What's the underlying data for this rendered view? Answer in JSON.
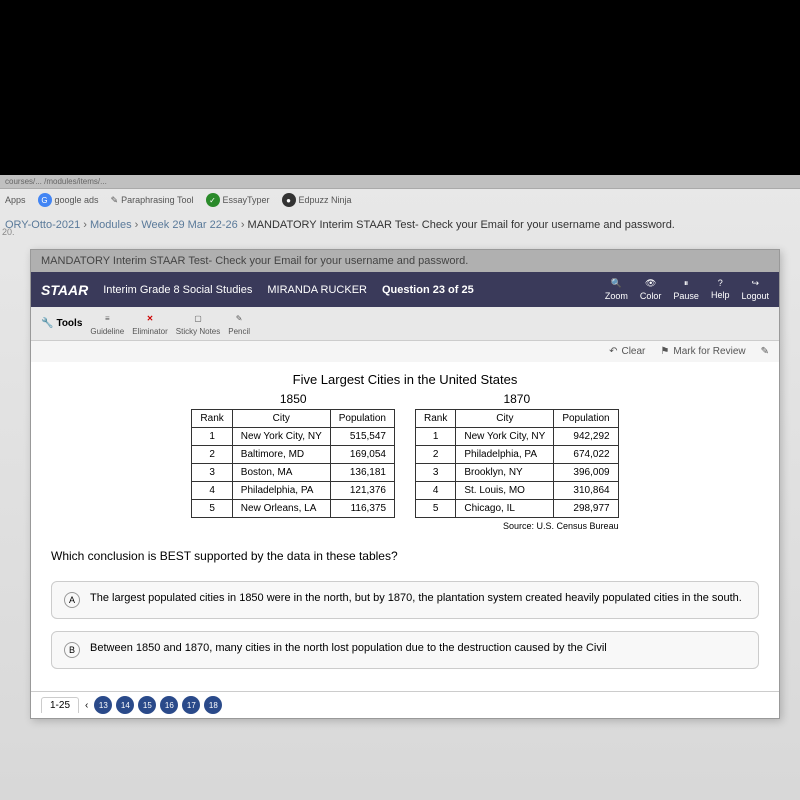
{
  "url_fragment": "courses/... /modules/items/...",
  "bookmarks": {
    "apps": "Apps",
    "google": "google ads",
    "paraphrase": "Paraphrasing Tool",
    "essaytyper": "EssayTyper",
    "edpuzz": "Edpuzz Ninja"
  },
  "breadcrumb": {
    "course": "ORY-Otto-2021",
    "modules": "Modules",
    "week": "Week 29 Mar 22-26",
    "item": "MANDATORY Interim STAAR Test- Check your Email for your username and password."
  },
  "left_note": "20.",
  "frame_title": "MANDATORY Interim STAAR Test- Check your Email for your username and password.",
  "staar": {
    "logo": "STAAR",
    "subtitle": "Interim Grade 8 Social Studies",
    "student": "MIRANDA RUCKER",
    "question_num": "Question 23 of 25",
    "zoom": "Zoom",
    "color": "Color",
    "pause": "Pause",
    "help": "Help",
    "logout": "Logout"
  },
  "tools": {
    "label": "Tools",
    "guideline": "Guideline",
    "eliminator": "Eliminator",
    "sticky": "Sticky Notes",
    "pencil": "Pencil"
  },
  "actions": {
    "clear": "Clear",
    "mark": "Mark for Review"
  },
  "chart_data": {
    "type": "table",
    "title": "Five Largest Cities in the United States",
    "tables": [
      {
        "year": "1850",
        "headers": [
          "Rank",
          "City",
          "Population"
        ],
        "rows": [
          [
            "1",
            "New York City, NY",
            "515,547"
          ],
          [
            "2",
            "Baltimore, MD",
            "169,054"
          ],
          [
            "3",
            "Boston, MA",
            "136,181"
          ],
          [
            "4",
            "Philadelphia, PA",
            "121,376"
          ],
          [
            "5",
            "New Orleans, LA",
            "116,375"
          ]
        ]
      },
      {
        "year": "1870",
        "headers": [
          "Rank",
          "City",
          "Population"
        ],
        "rows": [
          [
            "1",
            "New York City, NY",
            "942,292"
          ],
          [
            "2",
            "Philadelphia, PA",
            "674,022"
          ],
          [
            "3",
            "Brooklyn, NY",
            "396,009"
          ],
          [
            "4",
            "St. Louis, MO",
            "310,864"
          ],
          [
            "5",
            "Chicago, IL",
            "298,977"
          ]
        ]
      }
    ],
    "source": "Source: U.S. Census Bureau"
  },
  "question_text": "Which conclusion is BEST supported by the data in these tables?",
  "answers": {
    "a_letter": "A",
    "a_text": "The largest populated cities in 1850 were in the north, but by 1870, the plantation system created heavily populated cities in the south.",
    "b_letter": "B",
    "b_text": "Between 1850 and 1870, many cities in the north lost population due to the destruction caused by the Civil"
  },
  "pagination": {
    "tab": "1-25",
    "dots": [
      "13",
      "14",
      "15",
      "16",
      "17",
      "18"
    ]
  }
}
